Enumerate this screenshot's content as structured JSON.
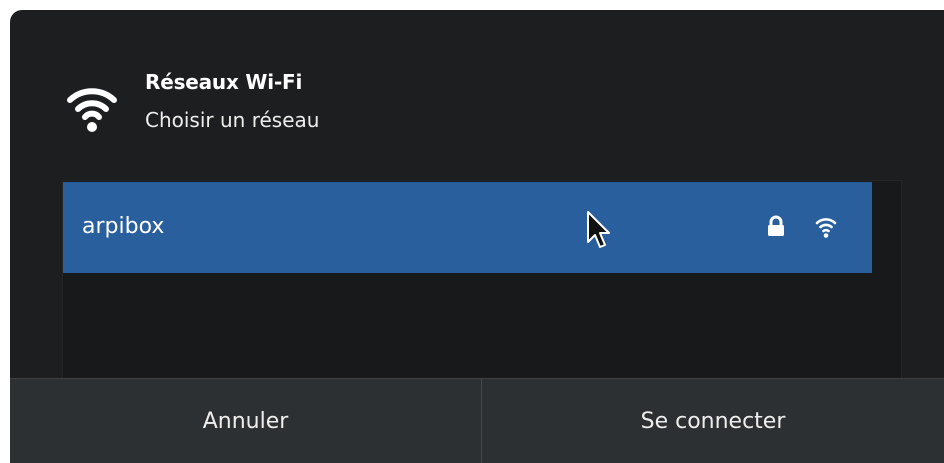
{
  "dialog": {
    "title": "Réseaux Wi-Fi",
    "subtitle": "Choisir un réseau",
    "header_icon": "wifi-icon"
  },
  "networks": [
    {
      "name": "arpibox",
      "selected": true,
      "secured": true,
      "icons": [
        "lock-icon",
        "wifi-signal-icon"
      ]
    }
  ],
  "buttons": {
    "cancel_label": "Annuler",
    "connect_label": "Se connecter"
  },
  "colors": {
    "dialog_bg": "#1c1e20",
    "selection": "#2a5f9e",
    "footer_bg": "#2d3033",
    "text": "#eeeeec"
  }
}
